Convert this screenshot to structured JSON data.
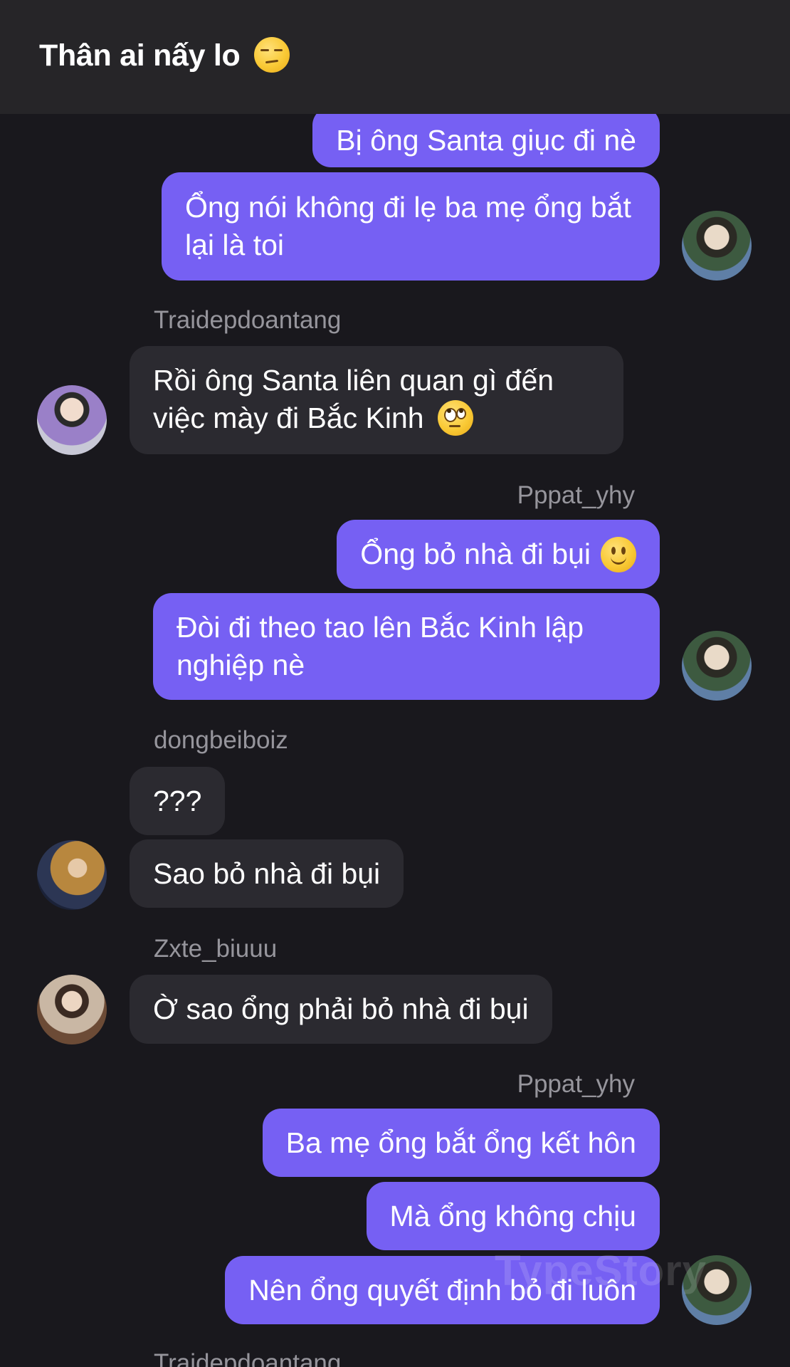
{
  "header": {
    "title": "Thân ai nấy lo",
    "title_emoji": "unamused-face-emoji"
  },
  "messages": [
    {
      "id": "m1",
      "direction": "out",
      "text": "Bị ông Santa giục đi nè"
    },
    {
      "id": "m2",
      "direction": "out",
      "text": "Ổng nói không đi lẹ ba mẹ ổng bắt lại là toi"
    },
    {
      "id": "m3",
      "direction": "in",
      "sender": "Traidepdoantang",
      "text": "Rồi ông Santa liên quan gì đến việc mày đi Bắc Kinh",
      "emoji": "face-with-rolling-eyes-emoji"
    },
    {
      "id": "m4",
      "direction": "out",
      "sender": "Pppat_yhy",
      "text": "Ổng bỏ nhà đi bụi",
      "emoji": "slightly-smiling-face-emoji"
    },
    {
      "id": "m5",
      "direction": "out",
      "text": "Đòi đi theo tao lên Bắc Kinh lập nghiệp nè"
    },
    {
      "id": "m6",
      "direction": "in",
      "sender": "dongbeiboiz",
      "text": "???"
    },
    {
      "id": "m7",
      "direction": "in",
      "text": "Sao bỏ nhà đi bụi"
    },
    {
      "id": "m8",
      "direction": "in",
      "sender": "Zxte_biuuu",
      "text": "Ờ sao ổng phải bỏ nhà đi bụi"
    },
    {
      "id": "m9",
      "direction": "out",
      "sender": "Pppat_yhy",
      "text": "Ba mẹ ổng bắt ổng kết hôn"
    },
    {
      "id": "m10",
      "direction": "out",
      "text": "Mà ổng không chịu"
    },
    {
      "id": "m11",
      "direction": "out",
      "text": "Nên ổng quyết định bỏ đi luôn"
    }
  ],
  "next_sender_partial": "Traidepdoantang",
  "watermark": "TypeStory"
}
